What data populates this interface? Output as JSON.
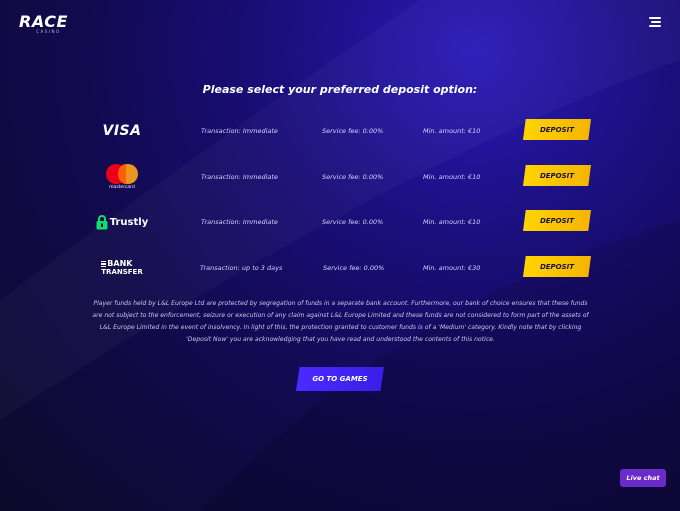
{
  "brand": {
    "name": "RACE",
    "sub": "CASINO"
  },
  "heading": "Please select your preferred deposit option:",
  "methods": [
    {
      "logo_text": "VISA",
      "transaction": "Transaction: Immediate",
      "fee": "Service fee: 0.00%",
      "min": "Min. amount: €10",
      "button": "DEPOSIT"
    },
    {
      "logo_text": "mastercard",
      "transaction": "Transaction: Immediate",
      "fee": "Service fee: 0.00%",
      "min": "Min. amount: €10",
      "button": "DEPOSIT"
    },
    {
      "logo_text": "Trustly",
      "transaction": "Transaction: Immediate",
      "fee": "Service fee: 0.00%",
      "min": "Min. amount: €10",
      "button": "DEPOSIT"
    },
    {
      "logo_text": "BANK",
      "logo_text2": "TRANSFER",
      "transaction": "Transaction: up to 3 days",
      "fee": "Service fee: 0.00%",
      "min": "Min. amount: €30",
      "button": "DEPOSIT"
    }
  ],
  "disclaimer": "Player funds held by L&L Europe Ltd are protected by segregation of funds in a separate bank account. Furthermore, our bank of choice ensures that these funds are not subject to the enforcement, seizure or execution of any claim against L&L Europe Limited and these funds are not considered to form part of the assets of L&L Europe Limited in the event of insolvency. In light of this, the protection granted to customer funds is of a 'Medium' category. Kindly note that by clicking 'Deposit Now' you are acknowledging that you have read and understood the contents of this notice.",
  "go_to_games": "GO TO GAMES",
  "live_chat": "Live chat",
  "colors": {
    "deposit_button": "#ffd400",
    "games_button": "#4b2bff",
    "live_chat": "#6b2bc9",
    "trustly_green": "#0ee06e",
    "mc_red": "#eb001b",
    "mc_orange": "#f79e1b"
  }
}
